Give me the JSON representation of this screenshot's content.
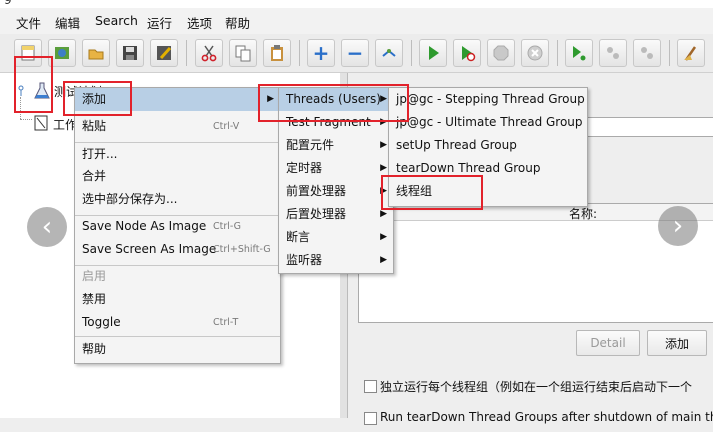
{
  "window": {
    "title_fragment": "9"
  },
  "menubar": {
    "items": [
      "文件",
      "编辑",
      "Search",
      "运行",
      "选项",
      "帮助"
    ]
  },
  "toolbar": {
    "icons": [
      "new-template-icon",
      "templates-icon",
      "open-icon",
      "save-icon",
      "save-as-icon",
      "cut-icon",
      "copy-icon",
      "paste-icon",
      "expand-icon",
      "collapse-icon",
      "toggle-icon",
      "start-icon",
      "start-no-pause-icon",
      "stop-icon",
      "shutdown-icon",
      "remote-start-icon",
      "remote-stop-icon",
      "remote-shutdown-icon",
      "clear-icon"
    ]
  },
  "tree": {
    "root_label": "测试计划",
    "child_label": "工作台"
  },
  "context_menu": {
    "items": [
      {
        "label": "添加",
        "shortcut": "",
        "submenu": true,
        "highlight": true
      },
      {
        "label": "粘贴",
        "shortcut": "Ctrl-V"
      },
      {
        "label": "打开...",
        "shortcut": ""
      },
      {
        "label": "合并",
        "shortcut": ""
      },
      {
        "label": "选中部分保存为...",
        "shortcut": ""
      },
      {
        "label": "Save Node As Image",
        "shortcut": "Ctrl-G"
      },
      {
        "label": "Save Screen As Image",
        "shortcut": "Ctrl+Shift-G"
      },
      {
        "label": "启用",
        "shortcut": "",
        "disabled": true
      },
      {
        "label": "禁用",
        "shortcut": ""
      },
      {
        "label": "Toggle",
        "shortcut": "Ctrl-T"
      },
      {
        "label": "帮助",
        "shortcut": ""
      }
    ]
  },
  "add_submenu": {
    "items": [
      {
        "label": "Threads (Users)",
        "highlight": true
      },
      {
        "label": "Test Fragment"
      },
      {
        "label": "配置元件"
      },
      {
        "label": "定时器"
      },
      {
        "label": "前置处理器"
      },
      {
        "label": "后置处理器"
      },
      {
        "label": "断言"
      },
      {
        "label": "监听器"
      }
    ]
  },
  "threads_submenu": {
    "items": [
      {
        "label": "jp@gc - Stepping Thread Group"
      },
      {
        "label": "jp@gc - Ultimate Thread Group"
      },
      {
        "label": "setUp Thread Group"
      },
      {
        "label": "tearDown Thread Group"
      },
      {
        "label": "线程组"
      }
    ]
  },
  "right_panel": {
    "name_column_label": "名称:",
    "detail_button": "Detail",
    "add_button": "添加",
    "option1": "独立运行每个线程组（例如在一个组运行结束后启动下一个",
    "option2": "Run tearDown Thread Groups after shutdown of main threa"
  },
  "colors": {
    "highlight": "#b8cfe5",
    "annotation": "#e2222b"
  }
}
